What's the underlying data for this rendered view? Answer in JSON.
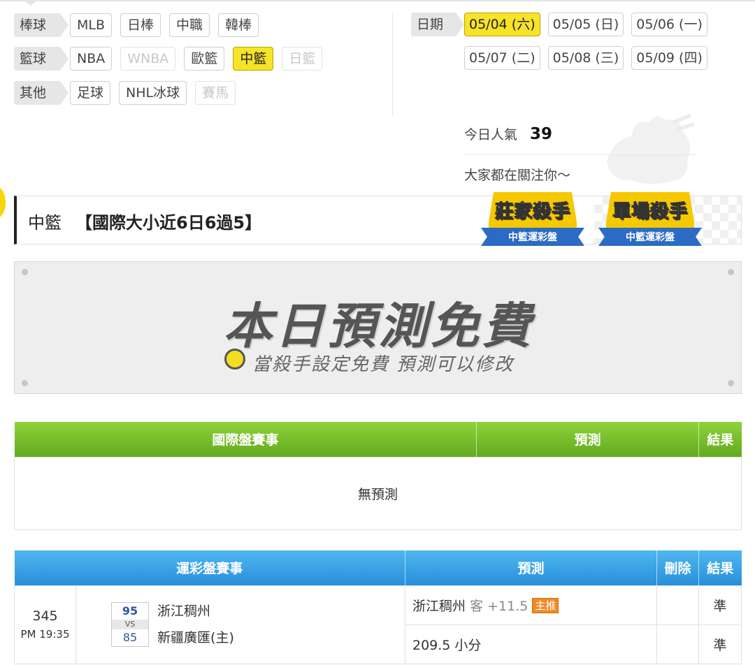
{
  "categories": [
    {
      "label": "棒球",
      "items": [
        {
          "text": "MLB",
          "state": "normal"
        },
        {
          "text": "日棒",
          "state": "normal"
        },
        {
          "text": "中職",
          "state": "normal"
        },
        {
          "text": "韓棒",
          "state": "normal"
        }
      ]
    },
    {
      "label": "籃球",
      "items": [
        {
          "text": "NBA",
          "state": "normal"
        },
        {
          "text": "WNBA",
          "state": "disabled"
        },
        {
          "text": "歐籃",
          "state": "normal"
        },
        {
          "text": "中籃",
          "state": "active"
        },
        {
          "text": "日籃",
          "state": "disabled"
        }
      ]
    },
    {
      "label": "其他",
      "items": [
        {
          "text": "足球",
          "state": "normal"
        },
        {
          "text": "NHL冰球",
          "state": "normal"
        },
        {
          "text": "賽馬",
          "state": "disabled"
        }
      ]
    }
  ],
  "dates": {
    "label": "日期",
    "row1": [
      {
        "text": "05/04 (六)",
        "active": true
      },
      {
        "text": "05/05 (日)",
        "active": false
      },
      {
        "text": "05/06 (一)",
        "active": false
      }
    ],
    "row2": [
      {
        "text": "05/07 (二)",
        "active": false
      },
      {
        "text": "05/08 (三)",
        "active": false
      },
      {
        "text": "05/09 (四)",
        "active": false
      }
    ]
  },
  "popularity": {
    "label": "今日人氣",
    "value": "39",
    "follow_text": "大家都在關注你～"
  },
  "title": {
    "league": "中籃",
    "record": "【國際大小近6日6過5】"
  },
  "badges": [
    {
      "main": "莊家殺手",
      "sub": "中籃運彩盤"
    },
    {
      "main": "單場殺手",
      "sub": "中籃運彩盤"
    }
  ],
  "promo": {
    "headline": "本日預測免費",
    "subline": "當殺手設定免費 預測可以修改"
  },
  "intl_table": {
    "headers": {
      "match": "國際盤賽事",
      "prediction": "預測",
      "result": "結果"
    },
    "empty_text": "無預測"
  },
  "lottery_table": {
    "headers": {
      "match": "運彩盤賽事",
      "prediction": "預測",
      "delete": "刪除",
      "result": "結果"
    },
    "rows": [
      {
        "no": "345",
        "time": "PM 19:35",
        "away_score": "95",
        "vs": "VS",
        "home_score": "85",
        "away_team": "浙江稠州",
        "home_team": "新疆廣匯(主)",
        "pred1_team": "浙江稠州",
        "pred1_side": "客 +11.5",
        "pred1_tag": "主推",
        "pred1_result": "準",
        "pred2_text": "209.5 小分",
        "pred2_result": "準"
      }
    ]
  },
  "colors": {
    "accent_yellow": "#f7e328",
    "green_header": "#6cb524",
    "blue_header": "#2a8fdb",
    "result_green": "#2e8b22",
    "tag_orange": "#f08a24"
  }
}
